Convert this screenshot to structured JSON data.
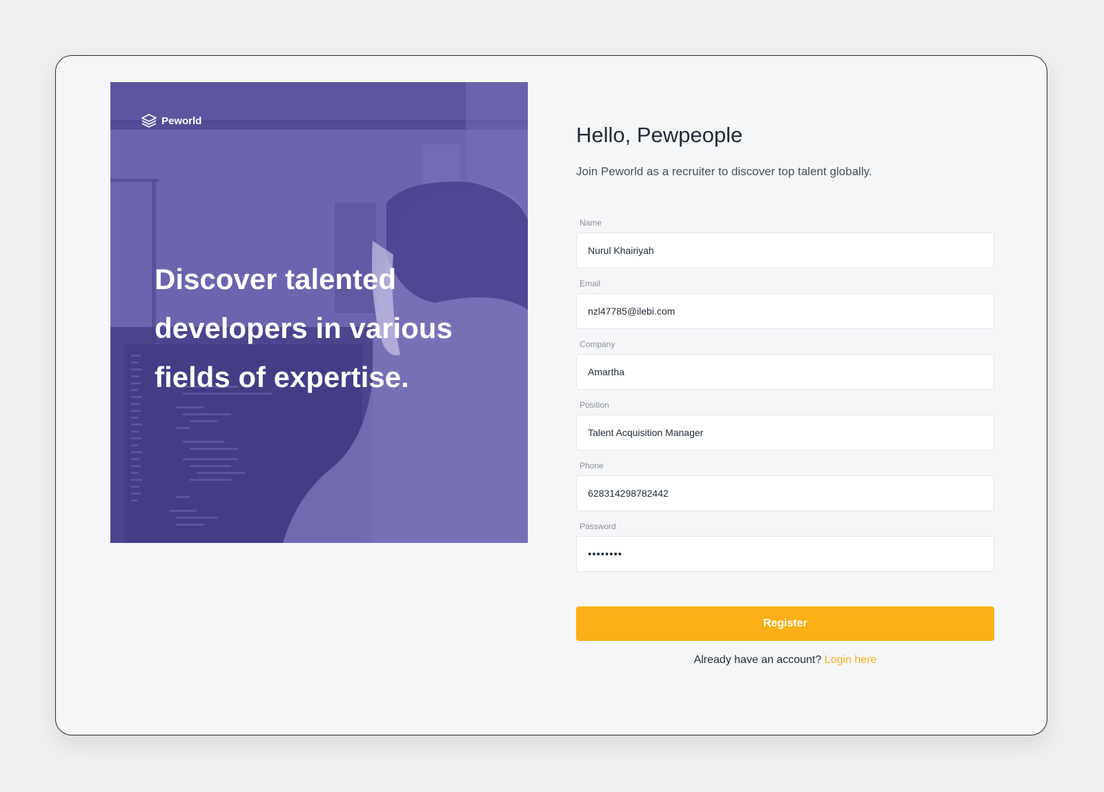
{
  "brand": {
    "name": "Peworld",
    "logo_icon": "stacked-layers-icon"
  },
  "hero": {
    "title_lines": [
      "Discover talented",
      "developers in various",
      "fields of expertise."
    ],
    "overlay_color": "#5e56a2"
  },
  "form": {
    "greeting": "Hello, Pewpeople",
    "subtitle": "Join Peworld as a recruiter to discover top talent globally.",
    "fields": [
      {
        "label": "Name",
        "value": "Nurul Khairiyah"
      },
      {
        "label": "Email",
        "value": "nzl47785@ilebi.com"
      },
      {
        "label": "Company",
        "value": "Amartha"
      },
      {
        "label": "Position",
        "value": "Talent Acquisition Manager"
      },
      {
        "label": "Phone",
        "value": "628314298782442"
      },
      {
        "label": "Password",
        "value": "••••••••"
      }
    ],
    "register_label": "Register",
    "login_prompt": "Already have an account?",
    "login_link": "Login here"
  },
  "colors": {
    "accent": "#fbb017",
    "heading": "#1f2a37",
    "background": "#f5f6f8"
  }
}
